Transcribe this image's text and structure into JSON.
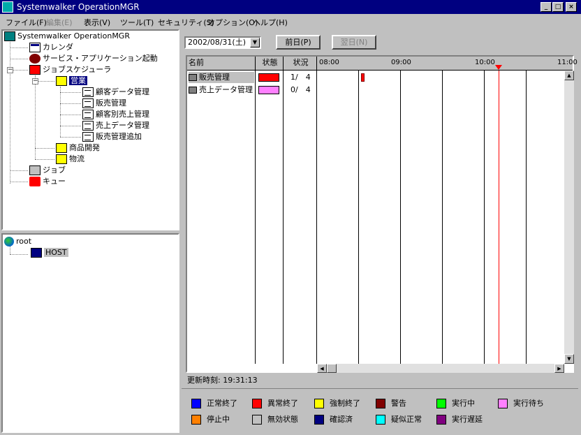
{
  "window": {
    "title": "Systemwalker OperationMGR"
  },
  "menu": [
    {
      "label": "ファイル(F)",
      "enabled": true
    },
    {
      "label": "編集(E)",
      "enabled": false
    },
    {
      "label": "表示(V)",
      "enabled": true
    },
    {
      "label": "ツール(T)",
      "enabled": true
    },
    {
      "label": "セキュリティ(S)",
      "enabled": true
    },
    {
      "label": "オプション(O)",
      "enabled": true
    },
    {
      "label": "ヘルプ(H)",
      "enabled": true
    }
  ],
  "tree": {
    "root": "Systemwalker OperationMGR",
    "calendar": "カレンダ",
    "service": "サービス・アプリケーション起動",
    "scheduler": "ジョブスケジューラ",
    "group_selected": "営業",
    "group_children": [
      "顧客データ管理",
      "販売管理",
      "顧客別売上管理",
      "売上データ管理",
      "販売管理追加"
    ],
    "other_groups": [
      "商品開発",
      "物流"
    ],
    "job": "ジョブ",
    "queue": "キュー"
  },
  "hosts": {
    "root": "root",
    "host": "HOST"
  },
  "toolbar": {
    "date_value": "2002/08/31(土)",
    "prev_button": "前日(P)",
    "next_button": "翌日(N)"
  },
  "grid": {
    "headers": {
      "name": "名前",
      "state": "状態",
      "status": "状況"
    },
    "time_ticks": [
      "08:00",
      "09:00",
      "10:00",
      "11:00"
    ],
    "rows": [
      {
        "name": "販売管理",
        "state_color": "#ff0000",
        "status": "1/　4"
      },
      {
        "name": "売上データ管理",
        "state_color": "#ff80ff",
        "status": "0/　4"
      }
    ]
  },
  "status_line": "更新時刻:  19:31:13",
  "legend": [
    {
      "label": "正常終了",
      "color": "#0000ff"
    },
    {
      "label": "異常終了",
      "color": "#ff0000"
    },
    {
      "label": "強制終了",
      "color": "#ffff00"
    },
    {
      "label": "警告",
      "color": "#800000"
    },
    {
      "label": "実行中",
      "color": "#00ff00"
    },
    {
      "label": "実行待ち",
      "color": "#ff80ff"
    },
    {
      "label": "停止中",
      "color": "#ff8000"
    },
    {
      "label": "無効状態",
      "color": "#c0c0c0"
    },
    {
      "label": "確認済",
      "color": "#000080"
    },
    {
      "label": "疑似正常",
      "color": "#00ffff"
    },
    {
      "label": "実行遅延",
      "color": "#800080"
    }
  ]
}
